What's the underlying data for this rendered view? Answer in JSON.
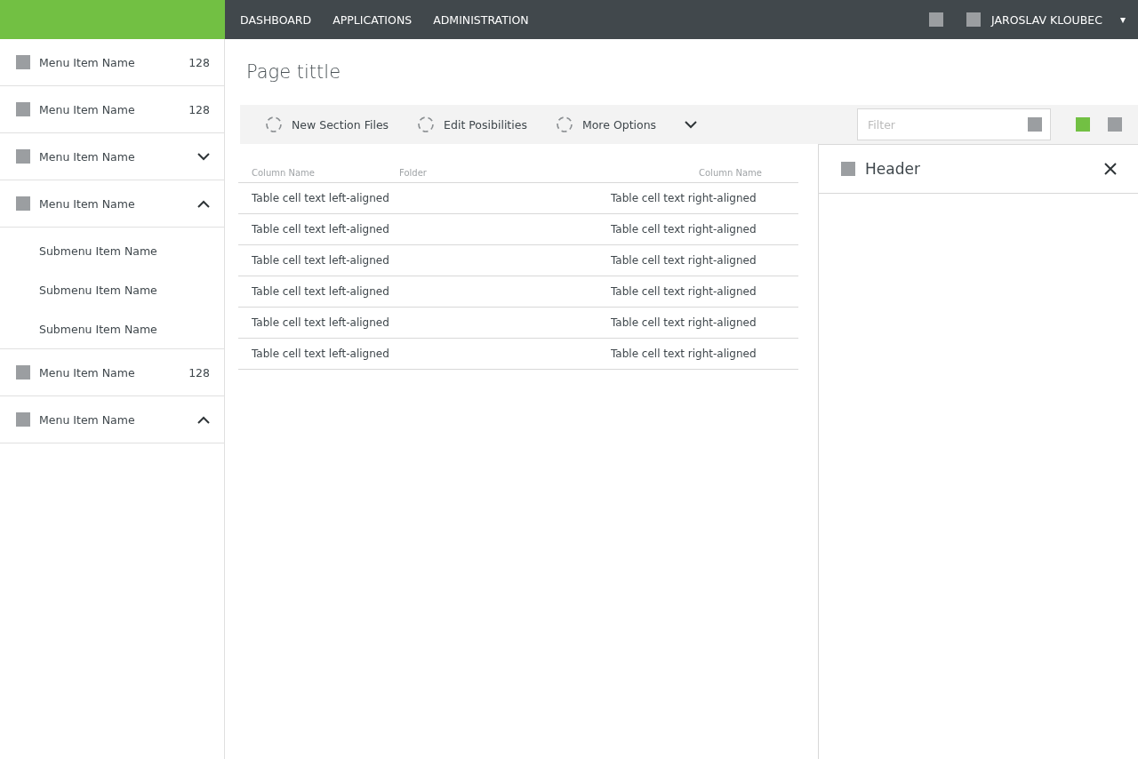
{
  "nav": {
    "tabs": [
      {
        "label": "DASHBOARD",
        "selected": false
      },
      {
        "label": "APPLICATIONS",
        "selected": false
      },
      {
        "label": "ADMINISTRATION",
        "selected": false
      }
    ],
    "user": "JAROSLAV KLOUBEC",
    "menu_glyph": "▾"
  },
  "sidebar": {
    "items": [
      {
        "label": "Menu Item Name",
        "kind": "count",
        "count": "128"
      },
      {
        "label": "Menu Item Name",
        "kind": "count",
        "count": "128"
      },
      {
        "label": "Menu Item Name",
        "kind": "expandable",
        "expanded": false
      },
      {
        "label": "Menu Item Name",
        "kind": "expandable",
        "expanded": true,
        "children": [
          {
            "label": "Submenu Item Name"
          },
          {
            "label": "Submenu Item Name"
          },
          {
            "label": "Submenu Item Name"
          }
        ]
      },
      {
        "label": "Menu Item Name",
        "kind": "count",
        "count": "128"
      },
      {
        "label": "Menu Item Name",
        "kind": "expandable",
        "expanded": true
      }
    ]
  },
  "page_title": "Page tittle",
  "toolbar": {
    "actions": [
      {
        "label": "New Section Files"
      },
      {
        "label": "Edit Posibilities"
      },
      {
        "label": "More Options"
      }
    ],
    "filter": {
      "placeholder": "Filter"
    },
    "views": [
      {
        "selected": true
      },
      {
        "selected": false
      }
    ]
  },
  "table": {
    "columns": [
      "Column Name",
      "Folder",
      "Column Name"
    ],
    "rows": [
      [
        "Table cell text left-aligned",
        "Table cell text right-aligned"
      ],
      [
        "Table cell text left-aligned",
        "Table cell text right-aligned"
      ],
      [
        "Table cell text left-aligned",
        "Table cell text right-aligned"
      ],
      [
        "Table cell text left-aligned",
        "Table cell text right-aligned"
      ],
      [
        "Table cell text left-aligned",
        "Table cell text right-aligned"
      ],
      [
        "Table cell text left-aligned",
        "Table cell text right-aligned"
      ]
    ]
  },
  "panel": {
    "header": "Header"
  }
}
